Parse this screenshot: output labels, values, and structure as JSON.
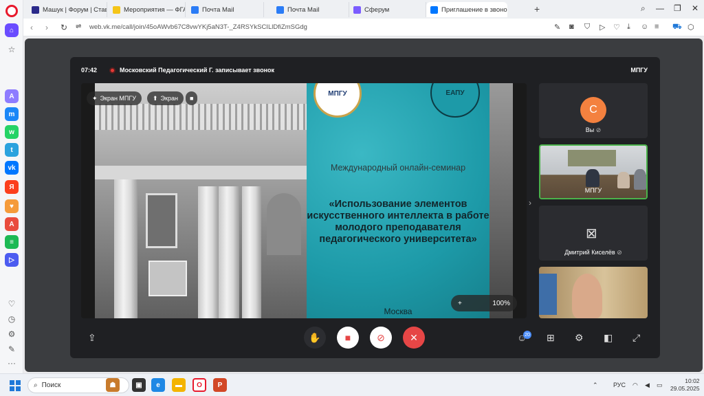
{
  "tabs": [
    {
      "label": "Машук | Форум | Ставроп",
      "color": "#2a2a8a"
    },
    {
      "label": "Мероприятия — ФГАИС",
      "color": "#f5c518"
    },
    {
      "label": "Почта Mail",
      "color": "#2b7cf6"
    },
    {
      "label": "Почта Mail",
      "color": "#2b7cf6"
    },
    {
      "label": "Сферум",
      "color": "#7b5cff"
    },
    {
      "label": "Приглашение в звонок",
      "color": "#0077ff"
    }
  ],
  "address": {
    "url": "web.vk.me/call/join/45oAWvb67C8vwYKj5aN3T-_Z4RSYkSCILlDfiZmSGdg"
  },
  "call": {
    "timer": "07:42",
    "recording_text": "Московский Педагогический Г. записывает звонок",
    "org": "МПГУ",
    "pill_screen_owner": "Экран МПГУ",
    "pill_screen": "Экран",
    "zoom": "100%",
    "participants_count": "20"
  },
  "slide": {
    "seal_left": "МПГУ",
    "seal_right": "ЕАПУ",
    "subtitle": "Международный онлайн-семинар",
    "title": "«Использование элементов искусственного интеллекта в работе молодого преподавателя педагогического университета»",
    "city": "Москва"
  },
  "tiles": [
    {
      "name": "Вы",
      "avatar_letter": "С"
    },
    {
      "name": "МПГУ"
    },
    {
      "name": "Дмитрий Киселёв"
    },
    {
      "name": ""
    }
  ],
  "taskbar": {
    "search_placeholder": "Поиск",
    "lang": "РУС",
    "time": "10:02",
    "date": "29.05.2025"
  }
}
